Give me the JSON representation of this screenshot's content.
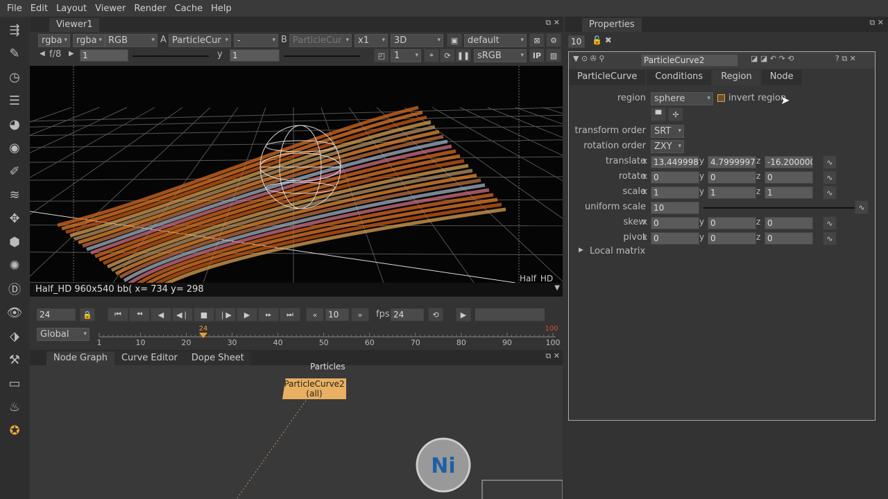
{
  "menu": [
    "File",
    "Edit",
    "Layout",
    "Viewer",
    "Render",
    "Cache",
    "Help"
  ],
  "toolbar_icons": [
    "viewer-icon",
    "paint-icon",
    "time-icon",
    "channel-icon",
    "color-icon",
    "filter-icon",
    "keyer-icon",
    "merge-icon",
    "transform-icon",
    "3d-icon",
    "particles-icon",
    "deep-icon",
    "views-icon",
    "metadata-icon",
    "toolsets-icon",
    "other-icon",
    "furnace-icon",
    "nuke-icon"
  ],
  "viewer": {
    "tab": "Viewer1",
    "row1": {
      "ch1": "rgba",
      "ch2": "rgba",
      "rgb": "RGB",
      "a_label": "A",
      "a_input": "ParticleCur",
      "op": "-",
      "b_label": "B",
      "b_input": "ParticleCur",
      "zoom": "x1",
      "mode": "3D",
      "lut": "default"
    },
    "row2": {
      "fstop": "f/8",
      "gain": "1",
      "gamma_label": "y",
      "gamma": "1",
      "proxy": "1",
      "colorspace": "sRGB",
      "ip": "IP"
    },
    "format_label": "Half_HD",
    "info": "Half_HD 960x540 bb(  x= 734 y= 298"
  },
  "timeline": {
    "frame": "24",
    "step": "10",
    "fps_label": "fps",
    "fps": "24",
    "range_mode": "Global",
    "current": "24",
    "start": "1",
    "end": "100",
    "ticks": [
      "1",
      "10",
      "20",
      "30",
      "40",
      "50",
      "60",
      "70",
      "80",
      "90",
      "100"
    ]
  },
  "bottom_tabs": [
    "Node Graph",
    "Curve Editor",
    "Dope Sheet"
  ],
  "nodes": {
    "particles": "Particles",
    "curve": "ParticleCurve2",
    "curve_sub": "(all)"
  },
  "properties": {
    "tab": "Properties",
    "max_panels": "10",
    "node_name": "ParticleCurve2",
    "tabs": [
      "ParticleCurve",
      "Conditions",
      "Region",
      "Node"
    ],
    "active_tab": "Region",
    "region_label": "region",
    "region": "sphere",
    "invert_label": "invert region",
    "invert": false,
    "transform_order_label": "transform order",
    "transform_order": "SRT",
    "rotation_order_label": "rotation order",
    "rotation_order": "ZXY",
    "rows": [
      {
        "label": "translate",
        "x": "13.449998",
        "y": "4.7999997",
        "z": "-16.200000"
      },
      {
        "label": "rotate",
        "x": "0",
        "y": "0",
        "z": "0"
      },
      {
        "label": "scale",
        "x": "1",
        "y": "1",
        "z": "1"
      },
      {
        "label": "skew",
        "x": "0",
        "y": "0",
        "z": "0"
      },
      {
        "label": "pivot",
        "x": "0",
        "y": "0",
        "z": "0"
      }
    ],
    "uniform_scale_label": "uniform scale",
    "uniform_scale": "10",
    "local_matrix": "Local matrix",
    "accent": "#e8a838"
  }
}
